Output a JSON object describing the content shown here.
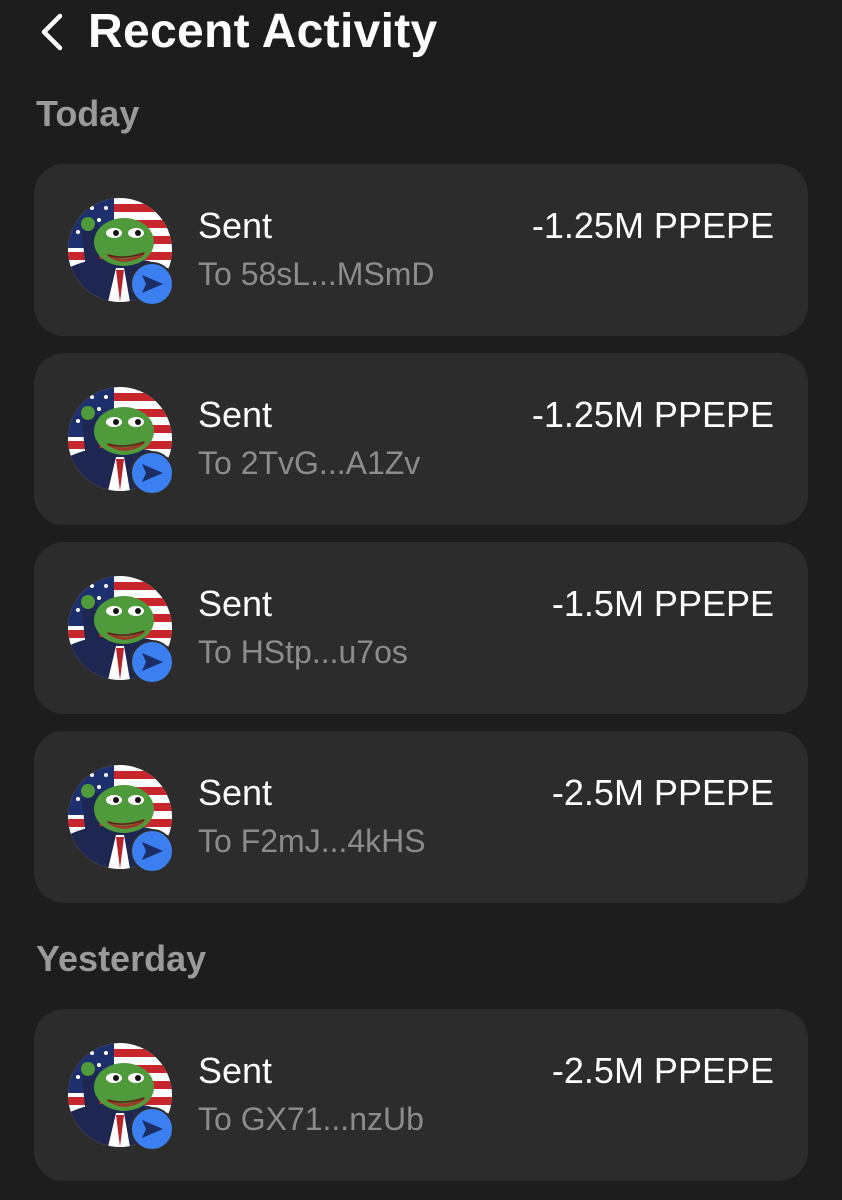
{
  "header": {
    "title": "Recent Activity",
    "back_icon": "chevron-left-icon"
  },
  "sections": [
    {
      "label": "Today",
      "items": [
        {
          "type": "Sent",
          "recipient": "To 58sL...MSmD",
          "amount": "-1.25M PPEPE"
        },
        {
          "type": "Sent",
          "recipient": "To 2TvG...A1Zv",
          "amount": "-1.25M PPEPE"
        },
        {
          "type": "Sent",
          "recipient": "To HStp...u7os",
          "amount": "-1.5M PPEPE"
        },
        {
          "type": "Sent",
          "recipient": "To F2mJ...4kHS",
          "amount": "-2.5M PPEPE"
        }
      ]
    },
    {
      "label": "Yesterday",
      "items": [
        {
          "type": "Sent",
          "recipient": "To GX71...nzUb",
          "amount": "-2.5M PPEPE"
        }
      ]
    }
  ],
  "colors": {
    "background": "#1d1d1d",
    "card": "#2c2c2c",
    "primary_text": "#ffffff",
    "secondary_text": "#8c8c8c",
    "section_label": "#9a9a9a",
    "badge": "#3b7ff0"
  },
  "icons": {
    "token_avatar": "token-avatar-icon",
    "sent_badge": "send-arrow-icon"
  }
}
